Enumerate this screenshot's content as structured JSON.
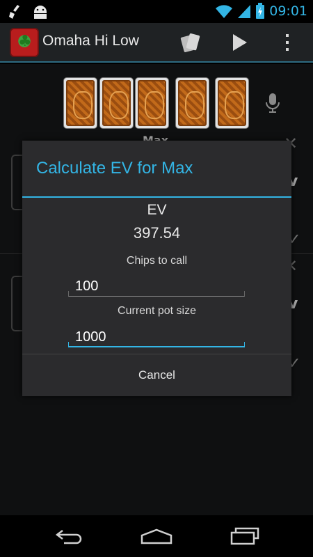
{
  "status_bar": {
    "time": "09:01",
    "icons": [
      "broom-icon",
      "android-icon",
      "wifi-icon",
      "signal-icon",
      "battery-charging-icon"
    ],
    "accent": "#33b5e5"
  },
  "action_bar": {
    "title": "Omaha Hi Low",
    "icons": [
      "app-logo-icon",
      "cards-icon",
      "play-icon",
      "overflow-menu-icon"
    ]
  },
  "board": {
    "card_count": 5,
    "mic_icon": "microphone-icon"
  },
  "background": {
    "player_name_partial": "Max"
  },
  "dialog": {
    "title": "Calculate EV for Max",
    "ev_label": "EV",
    "ev_value": "397.54",
    "chips_label": "Chips to call",
    "chips_value": "100",
    "pot_label": "Current pot size",
    "pot_value": "1000",
    "cancel_label": "Cancel"
  },
  "nav_bar": {
    "icons": [
      "back-icon",
      "home-icon",
      "recent-apps-icon"
    ]
  },
  "colors": {
    "accent": "#33b5e5",
    "dialog_bg": "#2b2b2d",
    "card_back": "#b05a15"
  }
}
